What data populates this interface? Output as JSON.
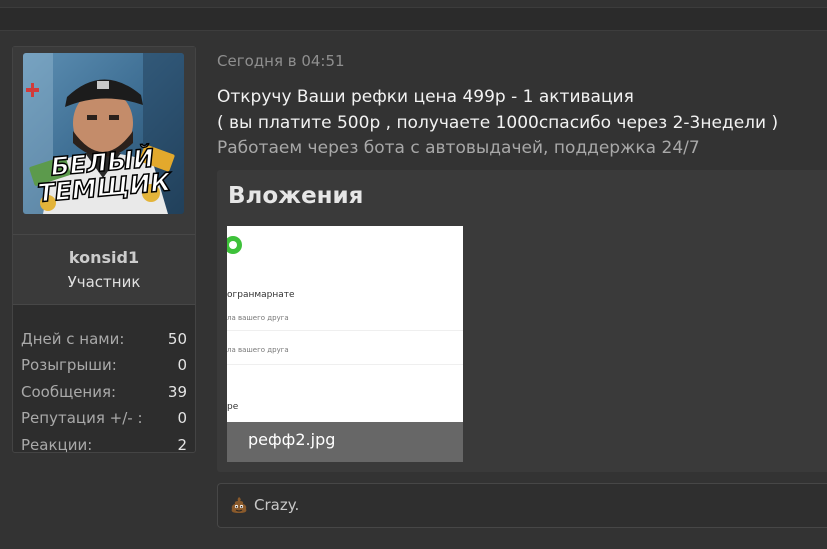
{
  "post": {
    "author": {
      "avatar_text_line1": "БЕЛЫЙ",
      "avatar_text_line2": "ТЕМЩИК",
      "name": "konsid1",
      "title": "Участник",
      "stats": [
        {
          "label": "Дней с нами:",
          "value": "50"
        },
        {
          "label": "Розыгрыши:",
          "value": "0"
        },
        {
          "label": "Сообщения:",
          "value": "39"
        },
        {
          "label": "Репутация +/- :",
          "value": "0"
        },
        {
          "label": "Реакции:",
          "value": "2"
        }
      ]
    },
    "date": "Сегодня в 04:51",
    "lines": [
      "Откручу Ваши рефки цена 499р - 1 активация",
      "( вы платите 500р , получаете 1000спасибо через 2-3недели )",
      "Работаем через бота с автовыдачей, поддержка 24/7"
    ],
    "attachments": {
      "title": "Вложения",
      "items": [
        {
          "filename": "рефф2.jpg",
          "preview_lines": [
            "огранмарнате",
            "ла вашего друга",
            "ла вашего друга",
            "ре"
          ]
        }
      ]
    },
    "reaction": {
      "icon": "poop-emoji-icon",
      "text": "Crazy."
    }
  },
  "colors": {
    "page_bg": "#2b2b2b",
    "post_bg": "#333333",
    "attach_bg": "#3a3a3a",
    "accent_green": "#3ec13a"
  }
}
